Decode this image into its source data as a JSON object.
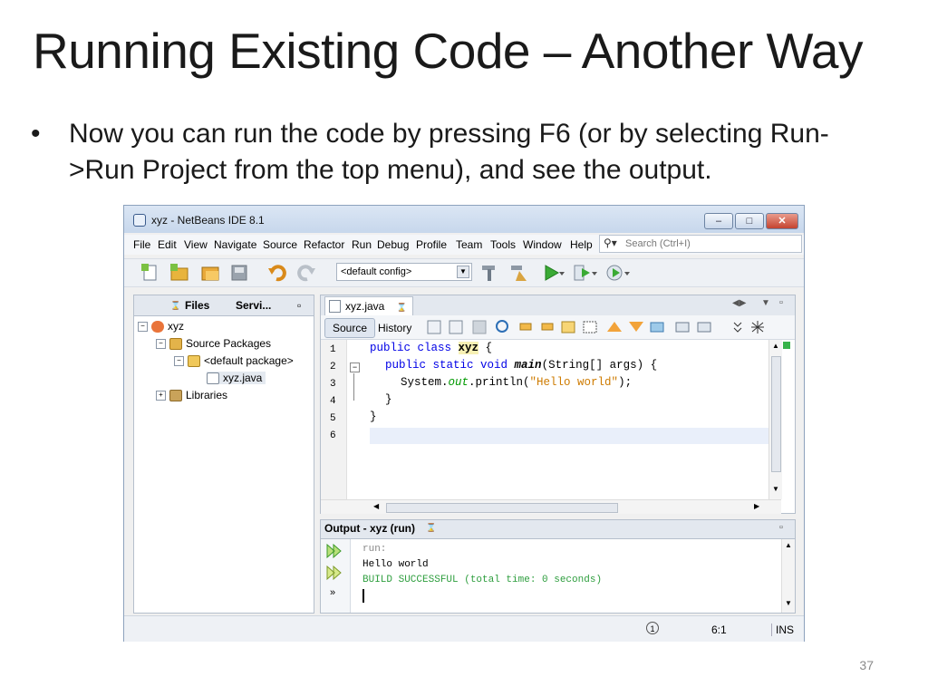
{
  "slide": {
    "title": "Running Existing Code – Another Way",
    "bullet_marker": "•",
    "bullet": "Now you can run the code by pressing F6 (or by selecting Run->Run Project from the top menu), and see the output.",
    "page_number": "37"
  },
  "window": {
    "title": "xyz - NetBeans IDE 8.1",
    "controls": [
      "–",
      "□",
      "✕"
    ]
  },
  "menu": [
    "File",
    "Edit",
    "View",
    "Navigate",
    "Source",
    "Refactor",
    "Run",
    "Debug",
    "Profile",
    "Team",
    "Tools",
    "Window",
    "Help"
  ],
  "search": {
    "placeholder": "Search (Ctrl+I)"
  },
  "toolbar": {
    "config": "<default config>"
  },
  "projects": {
    "tabs": [
      "Files",
      "Servi..."
    ],
    "tree": {
      "project": "xyz",
      "source_packages": "Source Packages",
      "default_package": "<default package>",
      "file": "xyz.java",
      "libraries": "Libraries"
    }
  },
  "editor": {
    "tab": "xyz.java",
    "source_label": "Source",
    "history_label": "History",
    "line_numbers": [
      "1",
      "2",
      "3",
      "4",
      "5",
      "6"
    ],
    "code": {
      "l1_kw": "public class",
      "l1_cls": "xyz",
      "l1_rest": " {",
      "l2_kw": "public static void",
      "l2_meth": "main",
      "l2_rest": "(String[] args) {",
      "l3_a": "System.",
      "l3_field": "out",
      "l3_b": ".println(",
      "l3_str": "\"Hello world\"",
      "l3_c": ");",
      "l4": "}",
      "l5": "}"
    }
  },
  "output": {
    "tab": "Output - xyz (run)",
    "lines": [
      "run:",
      "Hello world",
      "BUILD SUCCESSFUL (total time: 0 seconds)"
    ]
  },
  "status": {
    "position": "6:1",
    "mode": "INS"
  }
}
